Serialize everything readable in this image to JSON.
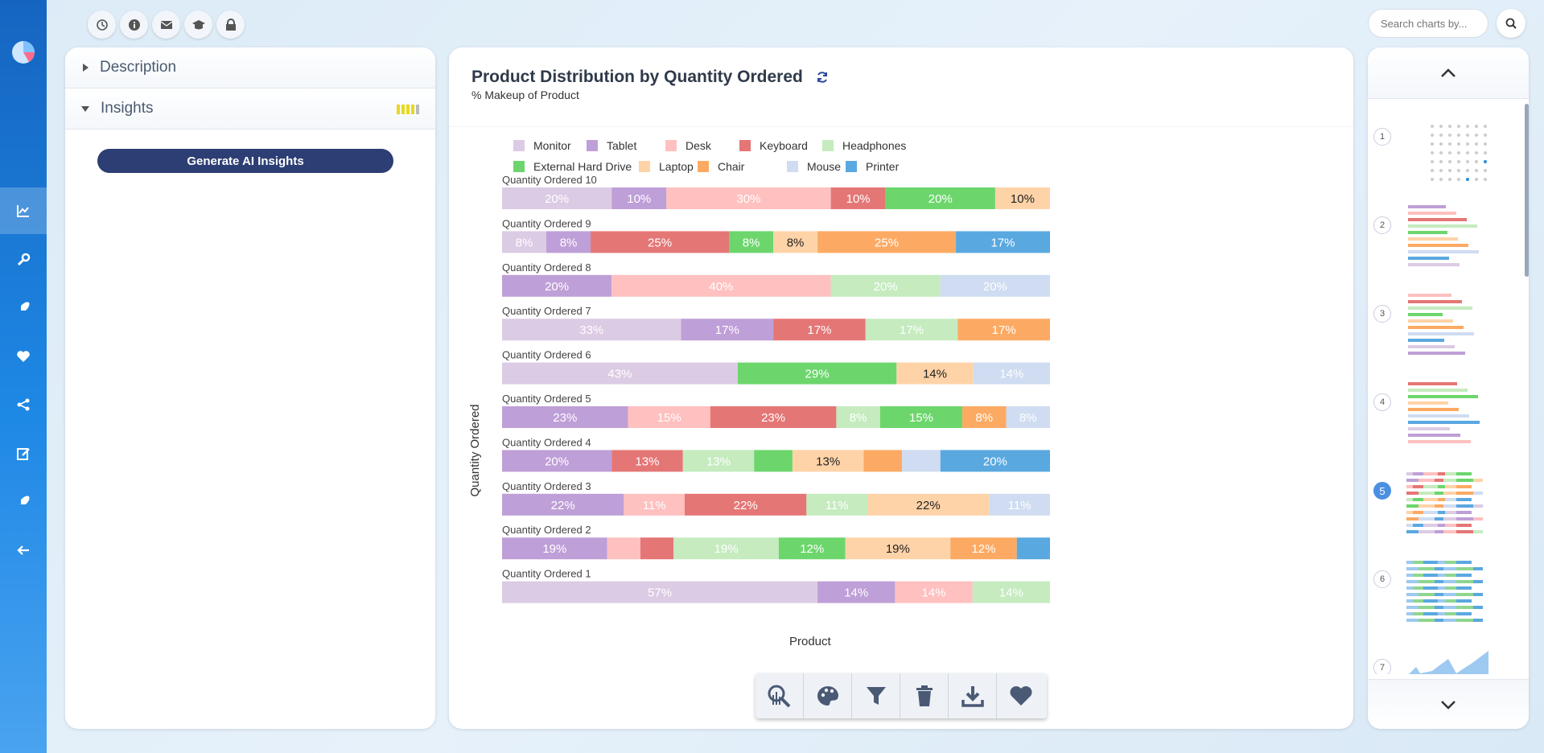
{
  "toolbar_top": {
    "buttons": [
      "history-icon",
      "info-icon",
      "mail-icon",
      "graduation-cap-icon",
      "lock-icon"
    ]
  },
  "search": {
    "placeholder": "Search charts by..."
  },
  "left_panel": {
    "description_label": "Description",
    "insights_label": "Insights",
    "generate_label": "Generate AI Insights"
  },
  "chart": {
    "title": "Product Distribution by Quantity Ordered",
    "subtitle": "% Makeup of Product",
    "xlabel": "Product",
    "ylabel": "Quantity Ordered"
  },
  "colors": {
    "Monitor": "#dccbe4",
    "Tablet": "#bf9fd7",
    "Desk": "#ffc0c0",
    "Keyboard": "#e57676",
    "Headphones": "#c5ebbf",
    "External Hard Drive": "#6cd66c",
    "Laptop": "#ffd3a8",
    "Chair": "#fcaa63",
    "Mouse": "#cfdcf1",
    "Printer": "#5aa8e0"
  },
  "chart_data": {
    "type": "bar",
    "orientation": "horizontal",
    "stacked": true,
    "percent": true,
    "legend": [
      "Monitor",
      "Tablet",
      "Desk",
      "Keyboard",
      "Headphones",
      "External Hard Drive",
      "Laptop",
      "Chair",
      "Mouse",
      "Printer"
    ],
    "legend_placement": "top",
    "rows": [
      {
        "label": "Quantity Ordered 10",
        "segments": [
          [
            "Monitor",
            20
          ],
          [
            "Tablet",
            10
          ],
          [
            "Desk",
            30
          ],
          [
            "Keyboard",
            10
          ],
          [
            "External Hard Drive",
            20
          ],
          [
            "Laptop",
            10
          ]
        ]
      },
      {
        "label": "Quantity Ordered 9",
        "segments": [
          [
            "Monitor",
            8
          ],
          [
            "Tablet",
            8
          ],
          [
            "Keyboard",
            25
          ],
          [
            "External Hard Drive",
            8
          ],
          [
            "Laptop",
            8
          ],
          [
            "Chair",
            25
          ],
          [
            "Printer",
            17
          ]
        ]
      },
      {
        "label": "Quantity Ordered 8",
        "segments": [
          [
            "Tablet",
            20
          ],
          [
            "Desk",
            40
          ],
          [
            "Headphones",
            20
          ],
          [
            "Mouse",
            20
          ]
        ]
      },
      {
        "label": "Quantity Ordered 7",
        "segments": [
          [
            "Monitor",
            33
          ],
          [
            "Tablet",
            17
          ],
          [
            "Keyboard",
            17
          ],
          [
            "Headphones",
            17
          ],
          [
            "Chair",
            17
          ]
        ]
      },
      {
        "label": "Quantity Ordered 6",
        "segments": [
          [
            "Monitor",
            43
          ],
          [
            "External Hard Drive",
            29
          ],
          [
            "Laptop",
            14
          ],
          [
            "Mouse",
            14
          ]
        ]
      },
      {
        "label": "Quantity Ordered 5",
        "segments": [
          [
            "Tablet",
            23
          ],
          [
            "Desk",
            15
          ],
          [
            "Keyboard",
            23
          ],
          [
            "Headphones",
            8
          ],
          [
            "External Hard Drive",
            15
          ],
          [
            "Chair",
            8
          ],
          [
            "Mouse",
            8
          ]
        ]
      },
      {
        "label": "Quantity Ordered 4",
        "segments": [
          [
            "Tablet",
            20
          ],
          [
            "Keyboard",
            13
          ],
          [
            "Headphones",
            13
          ],
          [
            "External Hard Drive",
            7
          ],
          [
            "Laptop",
            13
          ],
          [
            "Chair",
            7
          ],
          [
            "Mouse",
            7
          ],
          [
            "Printer",
            20
          ]
        ]
      },
      {
        "label": "Quantity Ordered 3",
        "segments": [
          [
            "Tablet",
            22
          ],
          [
            "Desk",
            11
          ],
          [
            "Keyboard",
            22
          ],
          [
            "Headphones",
            11
          ],
          [
            "Laptop",
            22
          ],
          [
            "Mouse",
            11
          ]
        ]
      },
      {
        "label": "Quantity Ordered 2",
        "segments": [
          [
            "Tablet",
            19
          ],
          [
            "Desk",
            6
          ],
          [
            "Keyboard",
            6
          ],
          [
            "Headphones",
            19
          ],
          [
            "External Hard Drive",
            12
          ],
          [
            "Laptop",
            19
          ],
          [
            "Chair",
            12
          ],
          [
            "Printer",
            6
          ]
        ]
      },
      {
        "label": "Quantity Ordered 1",
        "segments": [
          [
            "Monitor",
            57
          ],
          [
            "Tablet",
            14
          ],
          [
            "Desk",
            14
          ],
          [
            "Headphones",
            14
          ]
        ]
      }
    ],
    "hidden_labels_below": 8,
    "dark_text_series": [
      "Laptop"
    ]
  },
  "chart_toolbar": [
    "analyze-icon",
    "palette-icon",
    "filter-icon",
    "trash-icon",
    "download-icon",
    "heart-icon"
  ],
  "thumbnails": [
    "1",
    "2",
    "3",
    "4",
    "5",
    "6",
    "7"
  ],
  "selected_thumbnail": "5"
}
